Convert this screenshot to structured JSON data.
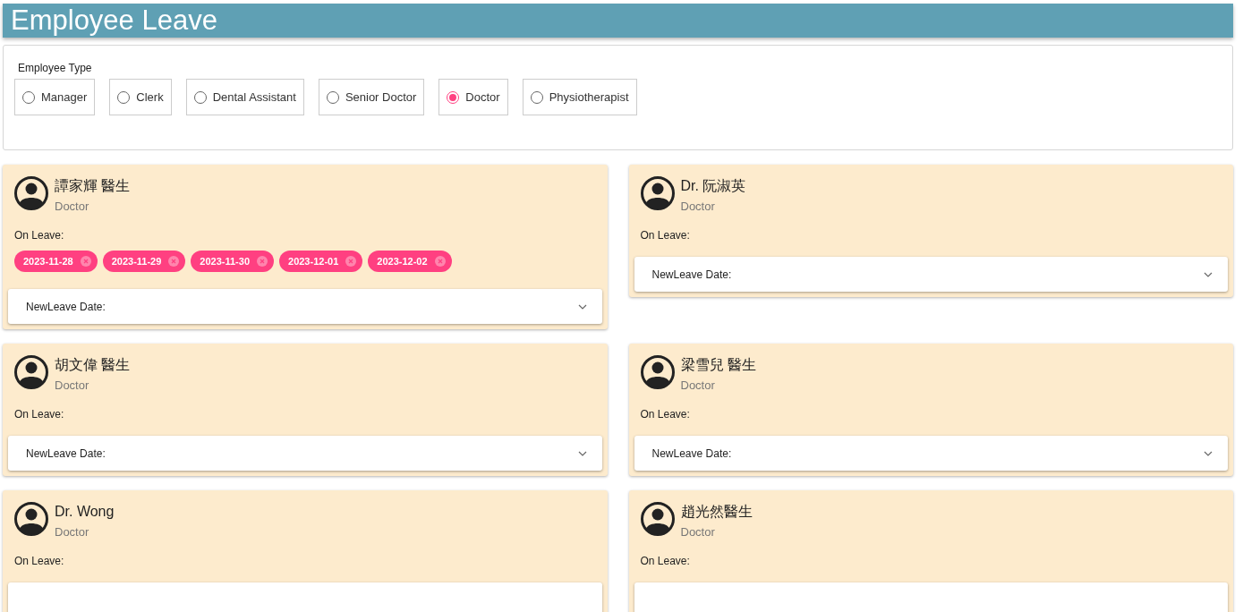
{
  "header": {
    "title": "Employee Leave"
  },
  "filter": {
    "label": "Employee Type",
    "options": [
      {
        "label": "Manager",
        "selected": false
      },
      {
        "label": "Clerk",
        "selected": false
      },
      {
        "label": "Dental Assistant",
        "selected": false
      },
      {
        "label": "Senior Doctor",
        "selected": false
      },
      {
        "label": "Doctor",
        "selected": true
      },
      {
        "label": "Physiotherapist",
        "selected": false
      }
    ]
  },
  "employees": [
    {
      "name": "譚家輝 醫生",
      "role": "Doctor",
      "leave_label": "On Leave:",
      "leave_dates": [
        "2023-11-28",
        "2023-11-29",
        "2023-11-30",
        "2023-12-01",
        "2023-12-02"
      ],
      "picker_label": "NewLeave Date:"
    },
    {
      "name": "Dr. 阮淑英",
      "role": "Doctor",
      "leave_label": "On Leave:",
      "picker_label": "NewLeave Date:"
    },
    {
      "name": "胡文偉 醫生",
      "role": "Doctor",
      "leave_label": "On Leave:",
      "picker_label": "NewLeave Date:"
    },
    {
      "name": "梁雪兒 醫生",
      "role": "Doctor",
      "leave_label": "On Leave:",
      "picker_label": "NewLeave Date:"
    },
    {
      "name": "Dr. Wong",
      "role": "Doctor",
      "leave_label": "On Leave:"
    },
    {
      "name": "趙光然醫生",
      "role": "Doctor",
      "leave_label": "On Leave:"
    }
  ]
}
